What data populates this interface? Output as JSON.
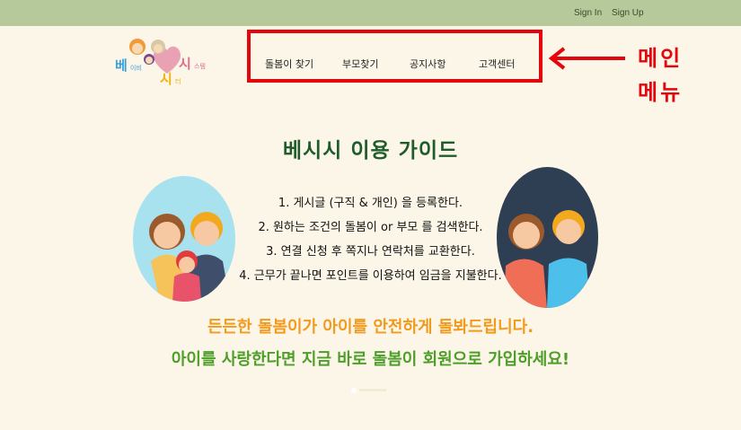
{
  "topbar": {
    "sign_in": "Sign In",
    "sign_up": "Sign Up"
  },
  "logo": {
    "text": "베이비시스템 시터"
  },
  "menu": {
    "items": [
      {
        "label": "돌봄이 찾기"
      },
      {
        "label": "부모찾기"
      },
      {
        "label": "공지사항"
      },
      {
        "label": "고객센터"
      }
    ]
  },
  "annotation": {
    "line1": "메인",
    "line2": "메뉴",
    "color": "#e4060c"
  },
  "guide": {
    "title": "베시시 이용 가이드",
    "steps": [
      "1. 게시글 (구직 & 개인) 을 등록한다.",
      "2. 원하는 조건의 돌봄이 or 부모 를 검색한다.",
      "3. 연결 신청 후 쪽지나 연락처를 교환한다.",
      "4. 근무가 끝나면 포인트를 이용하여 임금을 지불한다."
    ]
  },
  "promo": {
    "line1": "든든한 돌봄이가 아이를 안전하게 돌봐드립니다.",
    "line2": "아이를 사랑한다면 지금 바로 돌봄이 회원으로 가입하세요!"
  },
  "colors": {
    "topbar": "#b5c99a",
    "background": "#fbf6e8",
    "title_green": "#1f5c2b",
    "promo_orange": "#f29a1c",
    "promo_green": "#4e9e2a"
  },
  "icons": {
    "logo": "family-heart-logo",
    "left_image": "family-illustration",
    "right_image": "couple-illustration",
    "arrow": "left-arrow-icon"
  }
}
